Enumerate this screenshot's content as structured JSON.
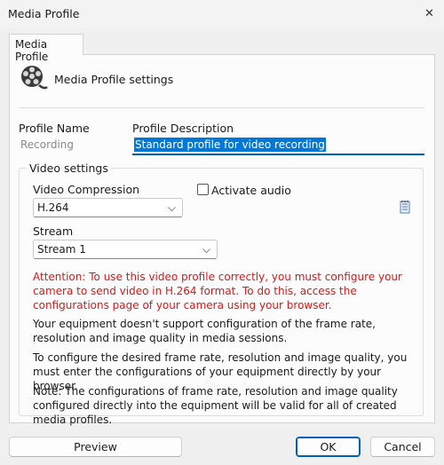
{
  "window": {
    "title": "Media Profile",
    "close_glyph": "✕"
  },
  "tab": {
    "label": "Media Profile"
  },
  "header": {
    "heading": "Media Profile settings",
    "icon": "film-reel-icon"
  },
  "profile": {
    "name_label": "Profile Name",
    "name_value": "Recording",
    "description_label": "Profile Description",
    "description_value": "Standard profile for video recording"
  },
  "video": {
    "group_label": "Video settings",
    "compression_label": "Video Compression",
    "compression_value": "H.264",
    "activate_audio_label": "Activate audio",
    "activate_audio_checked": false,
    "stream_label": "Stream",
    "stream_value": "Stream 1",
    "notepad_icon": "notepad-icon"
  },
  "messages": {
    "attention": "Attention: To use this video profile correctly, you must configure your camera to send video in H.264 format. To do this, access the configurations page of your camera using your browser.",
    "no_support": "Your equipment doesn't support configuration of the frame rate, resolution and image quality in media sessions.",
    "configure": "To configure the desired frame rate, resolution and image quality, you must enter the configurations of your equipment directly by your browser.",
    "note": "Note: The configurations of frame rate, resolution and image quality configured directly into the equipment will be valid for all of created media profiles."
  },
  "buttons": {
    "preview": "Preview",
    "ok": "OK",
    "cancel": "Cancel"
  },
  "colors": {
    "accent": "#005fb8",
    "warning": "#d11a1a",
    "selection": "#0078d7"
  }
}
